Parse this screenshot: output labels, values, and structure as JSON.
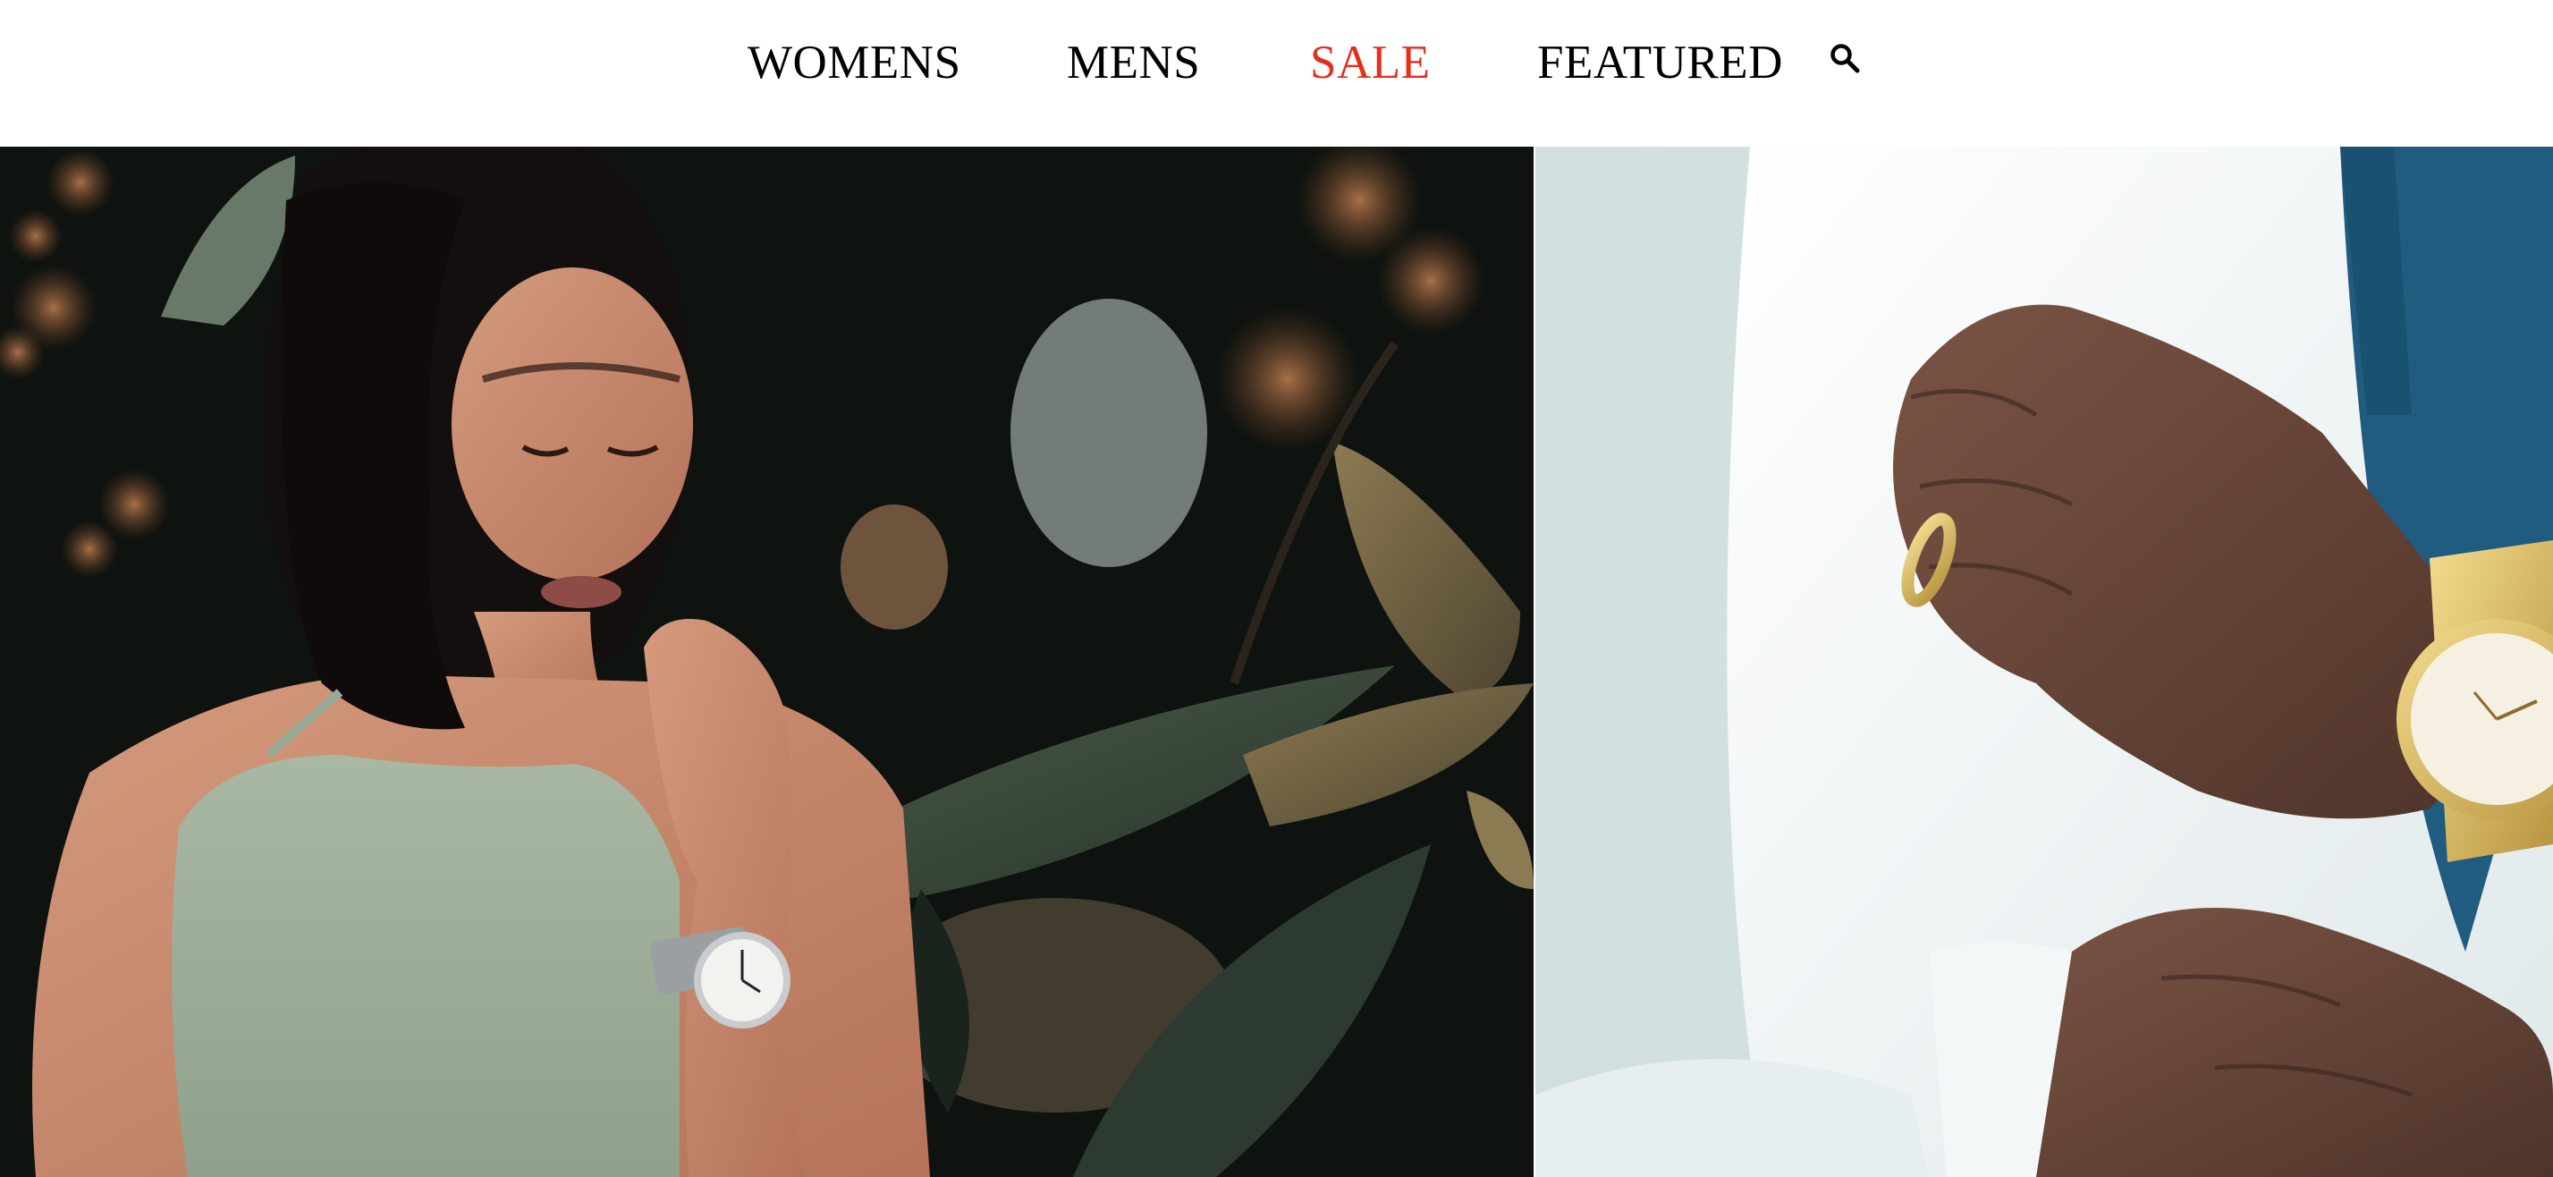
{
  "nav": {
    "items": [
      {
        "label": "WOMENS",
        "color": "#000000"
      },
      {
        "label": "MENS",
        "color": "#000000"
      },
      {
        "label": "SALE",
        "color": "#e52e1d"
      },
      {
        "label": "FEATURED",
        "color": "#000000"
      }
    ],
    "search_icon": "search-icon"
  },
  "hero": {
    "tiles": [
      {
        "subject": "woman-wearing-silver-mesh-watch-photo"
      },
      {
        "subject": "man-adjusting-cuff-gold-watch-photo"
      }
    ]
  }
}
